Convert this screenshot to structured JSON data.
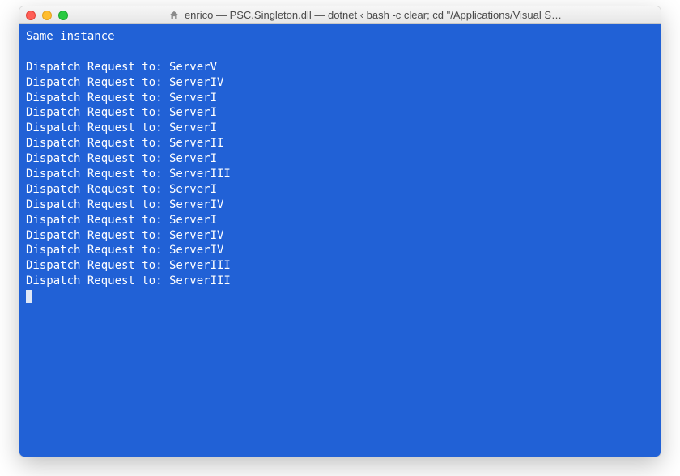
{
  "window": {
    "title": "enrico — PSC.Singleton.dll — dotnet ‹ bash -c clear; cd \"/Applications/Visual S…"
  },
  "terminal": {
    "intro": "Same instance",
    "prefix": "Dispatch Request to: ",
    "lines": [
      "ServerV",
      "ServerIV",
      "ServerI",
      "ServerI",
      "ServerI",
      "ServerII",
      "ServerI",
      "ServerIII",
      "ServerI",
      "ServerIV",
      "ServerI",
      "ServerIV",
      "ServerIV",
      "ServerIII",
      "ServerIII"
    ]
  }
}
